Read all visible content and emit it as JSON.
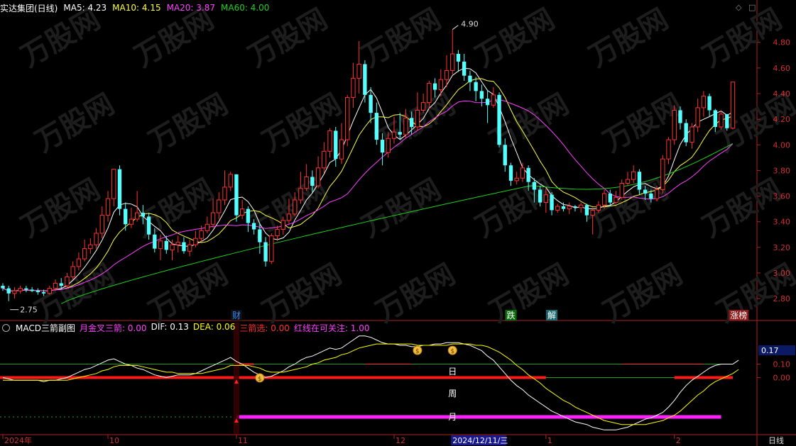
{
  "header": {
    "stock_name": "实达集团(日线)",
    "ma5_label": "MA5:",
    "ma5_value": "4.23",
    "ma10_label": "MA10:",
    "ma10_value": "4.15",
    "ma20_label": "MA20:",
    "ma20_value": "3.87",
    "ma60_label": "MA60:",
    "ma60_value": "4.00"
  },
  "indicator_header": {
    "name": "MACD三箭副图",
    "items": [
      {
        "label": "月金叉三箭:",
        "value": "0.00",
        "color": "#ff40ff"
      },
      {
        "label": "DIF:",
        "value": "0.13",
        "color": "#ffffff"
      },
      {
        "label": "DEA:",
        "value": "0.06",
        "color": "#ffff00"
      },
      {
        "label": "三箭选:",
        "value": "0.00",
        "color": "#ff3030"
      },
      {
        "label": "红线在可关注:",
        "value": "1.00",
        "color": "#ff40ff"
      }
    ]
  },
  "markers": {
    "high_label": "4.90",
    "low_label": "2.75",
    "tag_cai": "财",
    "tag_die": "跌",
    "tag_jie": "解",
    "tag_zhangbang": "涨榜",
    "row_ri": "日",
    "row_zhou": "周",
    "row_yue": "月"
  },
  "bottom_axis": {
    "labels": [
      "2024年",
      "10",
      "11",
      "12",
      "2024/12/11/三",
      "1",
      "2"
    ],
    "period": "日线"
  },
  "indicator_axis": {
    "current": "0.17",
    "ticks": [
      "0.10",
      "0.00"
    ]
  },
  "chart_data": [
    {
      "type": "candlestick",
      "title": "实达集团(日线)",
      "y_ticks": [
        "4.80",
        "4.60",
        "4.40",
        "4.20",
        "4.00",
        "3.80",
        "3.60",
        "3.40",
        "3.20",
        "3.00",
        "2.80"
      ],
      "ylim": [
        2.64,
        5.02
      ],
      "candles": [
        [
          2.9,
          2.88,
          2.92,
          2.86
        ],
        [
          2.88,
          2.84,
          2.9,
          2.78
        ],
        [
          2.84,
          2.86,
          2.89,
          2.8
        ],
        [
          2.86,
          2.88,
          2.9,
          2.84
        ],
        [
          2.88,
          2.87,
          2.9,
          2.85
        ],
        [
          2.87,
          2.86,
          2.89,
          2.85
        ],
        [
          2.86,
          2.85,
          2.88,
          2.83
        ],
        [
          2.85,
          2.84,
          2.87,
          2.82
        ],
        [
          2.84,
          2.88,
          2.9,
          2.83
        ],
        [
          2.88,
          2.92,
          2.95,
          2.86
        ],
        [
          2.92,
          2.9,
          2.96,
          2.88
        ],
        [
          2.9,
          2.97,
          3.0,
          2.88
        ],
        [
          2.97,
          3.05,
          3.09,
          2.95
        ],
        [
          3.05,
          3.11,
          3.16,
          3.02
        ],
        [
          3.11,
          3.19,
          3.26,
          3.09
        ],
        [
          3.19,
          3.22,
          3.27,
          3.15
        ],
        [
          3.22,
          3.31,
          3.35,
          3.19
        ],
        [
          3.31,
          3.45,
          3.52,
          3.27
        ],
        [
          3.45,
          3.58,
          3.64,
          3.4
        ],
        [
          3.58,
          3.81,
          3.81,
          3.52
        ],
        [
          3.81,
          3.5,
          3.84,
          3.45
        ],
        [
          3.5,
          3.38,
          3.55,
          3.33
        ],
        [
          3.38,
          3.42,
          3.51,
          3.35
        ],
        [
          3.42,
          3.47,
          3.64,
          3.4
        ],
        [
          3.47,
          3.44,
          3.53,
          3.38
        ],
        [
          3.44,
          3.3,
          3.47,
          3.26
        ],
        [
          3.3,
          3.19,
          3.35,
          3.16
        ],
        [
          3.19,
          3.25,
          3.3,
          3.1
        ],
        [
          3.25,
          3.18,
          3.29,
          3.15
        ],
        [
          3.18,
          3.22,
          3.26,
          3.1
        ],
        [
          3.22,
          3.24,
          3.29,
          3.16
        ],
        [
          3.24,
          3.17,
          3.28,
          3.15
        ],
        [
          3.17,
          3.22,
          3.26,
          3.13
        ],
        [
          3.22,
          3.27,
          3.33,
          3.2
        ],
        [
          3.27,
          3.33,
          3.37,
          3.24
        ],
        [
          3.33,
          3.38,
          3.44,
          3.31
        ],
        [
          3.38,
          3.47,
          3.58,
          3.35
        ],
        [
          3.47,
          3.57,
          3.63,
          3.42
        ],
        [
          3.57,
          3.67,
          3.8,
          3.53
        ],
        [
          3.67,
          3.77,
          3.79,
          3.64
        ],
        [
          3.77,
          3.45,
          3.77,
          3.4
        ],
        [
          3.45,
          3.5,
          3.57,
          3.42
        ],
        [
          3.5,
          3.39,
          3.52,
          3.32
        ],
        [
          3.39,
          3.34,
          3.42,
          3.3
        ],
        [
          3.34,
          3.24,
          3.39,
          3.15
        ],
        [
          3.24,
          3.09,
          3.28,
          3.05
        ],
        [
          3.09,
          3.29,
          3.31,
          3.07
        ],
        [
          3.29,
          3.34,
          3.37,
          3.25
        ],
        [
          3.34,
          3.41,
          3.44,
          3.3
        ],
        [
          3.41,
          3.46,
          3.58,
          3.38
        ],
        [
          3.46,
          3.57,
          3.63,
          3.44
        ],
        [
          3.57,
          3.66,
          3.79,
          3.54
        ],
        [
          3.66,
          3.75,
          3.85,
          3.64
        ],
        [
          3.75,
          3.68,
          3.8,
          3.62
        ],
        [
          3.68,
          3.82,
          3.91,
          3.66
        ],
        [
          3.82,
          3.95,
          4.02,
          3.78
        ],
        [
          3.95,
          4.11,
          4.13,
          3.9
        ],
        [
          4.11,
          3.89,
          4.14,
          3.83
        ],
        [
          3.89,
          4.04,
          4.17,
          3.85
        ],
        [
          4.04,
          4.37,
          4.39,
          3.99
        ],
        [
          4.37,
          4.52,
          4.64,
          4.29
        ],
        [
          4.52,
          4.63,
          4.81,
          4.4
        ],
        [
          4.63,
          4.39,
          4.66,
          4.33
        ],
        [
          4.39,
          4.25,
          4.45,
          4.17
        ],
        [
          4.25,
          4.04,
          4.33,
          4.0
        ],
        [
          4.04,
          3.94,
          4.09,
          3.84
        ],
        [
          3.94,
          4.05,
          4.1,
          3.9
        ],
        [
          4.05,
          4.1,
          4.22,
          4.01
        ],
        [
          4.1,
          4.08,
          4.25,
          4.04
        ],
        [
          4.08,
          4.21,
          4.28,
          4.05
        ],
        [
          4.21,
          4.14,
          4.26,
          4.08
        ],
        [
          4.14,
          4.27,
          4.41,
          4.11
        ],
        [
          4.27,
          4.33,
          4.4,
          4.25
        ],
        [
          4.33,
          4.48,
          4.5,
          4.28
        ],
        [
          4.48,
          4.43,
          4.52,
          4.37
        ],
        [
          4.43,
          4.51,
          4.59,
          4.38
        ],
        [
          4.51,
          4.58,
          4.7,
          4.45
        ],
        [
          4.58,
          4.71,
          4.9,
          4.55
        ],
        [
          4.71,
          4.65,
          4.74,
          4.57
        ],
        [
          4.65,
          4.54,
          4.71,
          4.5
        ],
        [
          4.54,
          4.49,
          4.58,
          4.42
        ],
        [
          4.49,
          4.42,
          4.53,
          4.34
        ],
        [
          4.42,
          4.36,
          4.47,
          4.3
        ],
        [
          4.36,
          4.31,
          4.43,
          4.17
        ],
        [
          4.31,
          4.39,
          4.45,
          4.29
        ],
        [
          4.39,
          4.0,
          4.41,
          3.98
        ],
        [
          4.0,
          3.84,
          4.05,
          3.79
        ],
        [
          3.84,
          3.72,
          3.86,
          3.68
        ],
        [
          3.72,
          3.74,
          3.79,
          3.69
        ],
        [
          3.74,
          3.82,
          3.86,
          3.71
        ],
        [
          3.82,
          3.71,
          3.84,
          3.64
        ],
        [
          3.71,
          3.65,
          3.74,
          3.55
        ],
        [
          3.65,
          3.55,
          3.68,
          3.52
        ],
        [
          3.55,
          3.61,
          3.66,
          3.47
        ],
        [
          3.61,
          3.49,
          3.63,
          3.45
        ],
        [
          3.49,
          3.52,
          3.54,
          3.47
        ],
        [
          3.52,
          3.5,
          3.55,
          3.48
        ],
        [
          3.5,
          3.52,
          3.55,
          3.46
        ],
        [
          3.52,
          3.51,
          3.53,
          3.48
        ],
        [
          3.51,
          3.53,
          3.55,
          3.47
        ],
        [
          3.53,
          3.45,
          3.54,
          3.4
        ],
        [
          3.45,
          3.49,
          3.51,
          3.3
        ],
        [
          3.49,
          3.53,
          3.56,
          3.47
        ],
        [
          3.53,
          3.62,
          3.65,
          3.5
        ],
        [
          3.62,
          3.55,
          3.65,
          3.52
        ],
        [
          3.55,
          3.59,
          3.64,
          3.54
        ],
        [
          3.59,
          3.7,
          3.73,
          3.57
        ],
        [
          3.7,
          3.73,
          3.79,
          3.68
        ],
        [
          3.73,
          3.79,
          3.84,
          3.7
        ],
        [
          3.79,
          3.65,
          3.81,
          3.61
        ],
        [
          3.65,
          3.62,
          3.68,
          3.57
        ],
        [
          3.62,
          3.58,
          3.65,
          3.55
        ],
        [
          3.58,
          3.65,
          3.68,
          3.56
        ],
        [
          3.65,
          3.89,
          3.92,
          3.62
        ],
        [
          3.89,
          4.04,
          4.06,
          3.85
        ],
        [
          4.04,
          4.27,
          4.31,
          4.0
        ],
        [
          4.27,
          4.17,
          4.3,
          4.12
        ],
        [
          4.17,
          4.02,
          4.2,
          3.99
        ],
        [
          4.02,
          4.14,
          4.17,
          3.97
        ],
        [
          4.14,
          4.29,
          4.36,
          4.1
        ],
        [
          4.29,
          4.38,
          4.42,
          4.22
        ],
        [
          4.38,
          4.27,
          4.4,
          4.22
        ],
        [
          4.27,
          4.14,
          4.28,
          4.1
        ],
        [
          4.14,
          4.24,
          4.27,
          4.12
        ],
        [
          4.24,
          4.13,
          4.24,
          4.11
        ],
        [
          4.13,
          4.49,
          4.49,
          4.12
        ]
      ],
      "series": [
        {
          "name": "MA5",
          "color": "#ffffff"
        },
        {
          "name": "MA10",
          "color": "#ffff40"
        },
        {
          "name": "MA20",
          "color": "#ff40ff"
        },
        {
          "name": "MA60",
          "color": "#20d020"
        }
      ]
    },
    {
      "type": "line",
      "title": "MACD三箭副图",
      "ylim": [
        -0.42,
        0.33
      ],
      "y_ticks": [
        0.1,
        0.0
      ],
      "series": [
        {
          "name": "DIF",
          "color": "#ffffff",
          "values": [
            0.0,
            -0.01,
            -0.02,
            -0.02,
            -0.02,
            -0.02,
            -0.02,
            -0.03,
            -0.02,
            -0.02,
            -0.01,
            0.0,
            0.02,
            0.04,
            0.06,
            0.07,
            0.09,
            0.11,
            0.13,
            0.14,
            0.12,
            0.1,
            0.09,
            0.07,
            0.06,
            0.04,
            0.02,
            0.01,
            0.0,
            0.01,
            0.02,
            0.02,
            0.02,
            0.03,
            0.05,
            0.07,
            0.09,
            0.11,
            0.13,
            0.15,
            0.12,
            0.1,
            0.07,
            0.04,
            0.02,
            0.0,
            0.01,
            0.03,
            0.05,
            0.08,
            0.1,
            0.13,
            0.15,
            0.16,
            0.18,
            0.2,
            0.22,
            0.21,
            0.22,
            0.25,
            0.28,
            0.31,
            0.31,
            0.3,
            0.28,
            0.26,
            0.25,
            0.25,
            0.24,
            0.24,
            0.23,
            0.23,
            0.24,
            0.24,
            0.25,
            0.25,
            0.26,
            0.26,
            0.26,
            0.25,
            0.24,
            0.22,
            0.2,
            0.16,
            0.13,
            0.08,
            0.03,
            -0.02,
            -0.06,
            -0.09,
            -0.13,
            -0.16,
            -0.19,
            -0.22,
            -0.25,
            -0.27,
            -0.29,
            -0.31,
            -0.33,
            -0.34,
            -0.35,
            -0.37,
            -0.38,
            -0.39,
            -0.39,
            -0.39,
            -0.38,
            -0.37,
            -0.35,
            -0.33,
            -0.31,
            -0.3,
            -0.28,
            -0.26,
            -0.22,
            -0.17,
            -0.11,
            -0.06,
            -0.02,
            0.01,
            0.04,
            0.07,
            0.09,
            0.1,
            0.1,
            0.1,
            0.13
          ]
        },
        {
          "name": "DEA",
          "color": "#ffff00",
          "values": [
            -0.02,
            -0.02,
            -0.02,
            -0.02,
            -0.02,
            -0.02,
            -0.02,
            -0.02,
            -0.02,
            -0.02,
            -0.02,
            -0.02,
            -0.01,
            0.0,
            0.01,
            0.02,
            0.03,
            0.05,
            0.06,
            0.08,
            0.09,
            0.09,
            0.09,
            0.09,
            0.08,
            0.07,
            0.06,
            0.05,
            0.04,
            0.04,
            0.03,
            0.03,
            0.03,
            0.03,
            0.03,
            0.04,
            0.05,
            0.06,
            0.07,
            0.09,
            0.09,
            0.09,
            0.09,
            0.08,
            0.07,
            0.05,
            0.04,
            0.04,
            0.04,
            0.05,
            0.06,
            0.07,
            0.08,
            0.1,
            0.11,
            0.13,
            0.14,
            0.15,
            0.17,
            0.18,
            0.2,
            0.22,
            0.23,
            0.24,
            0.25,
            0.25,
            0.25,
            0.25,
            0.25,
            0.25,
            0.25,
            0.24,
            0.24,
            0.24,
            0.24,
            0.24,
            0.24,
            0.25,
            0.25,
            0.25,
            0.25,
            0.24,
            0.24,
            0.23,
            0.21,
            0.19,
            0.16,
            0.13,
            0.09,
            0.06,
            0.02,
            -0.01,
            -0.04,
            -0.08,
            -0.11,
            -0.14,
            -0.17,
            -0.19,
            -0.22,
            -0.24,
            -0.26,
            -0.28,
            -0.3,
            -0.32,
            -0.33,
            -0.34,
            -0.35,
            -0.35,
            -0.35,
            -0.35,
            -0.35,
            -0.34,
            -0.33,
            -0.32,
            -0.3,
            -0.28,
            -0.25,
            -0.21,
            -0.17,
            -0.13,
            -0.1,
            -0.06,
            -0.03,
            -0.01,
            0.01,
            0.03,
            0.06
          ]
        }
      ]
    }
  ]
}
